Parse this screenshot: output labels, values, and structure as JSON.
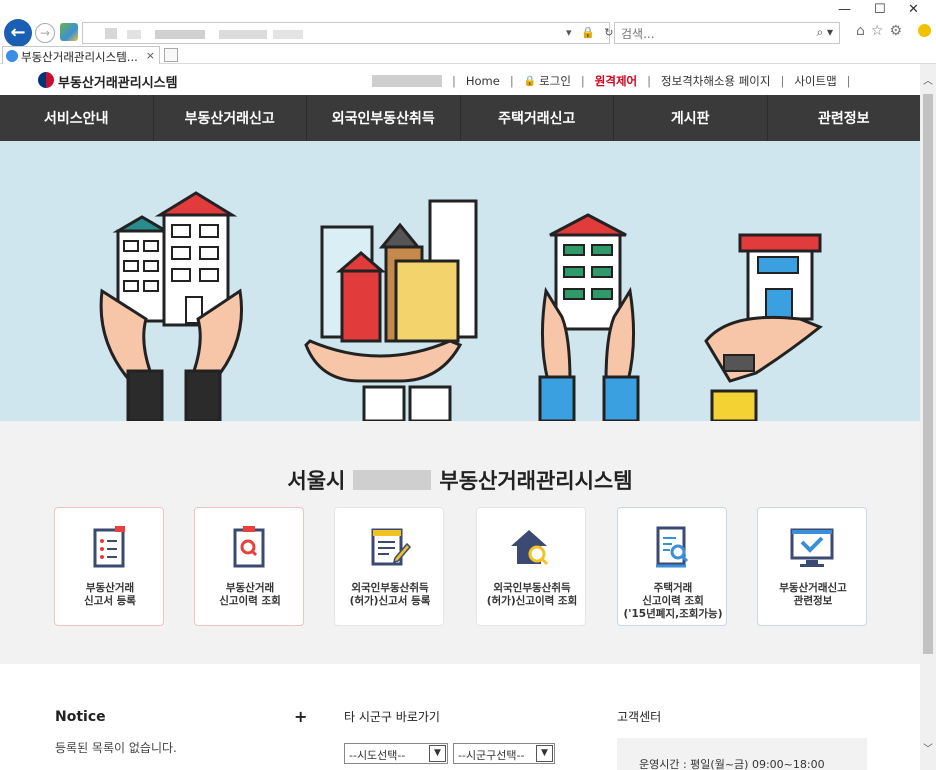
{
  "browser": {
    "window_controls": {
      "minimize": "—",
      "maximize": "☐",
      "close": "✕"
    },
    "search": {
      "placeholder": "검색..."
    },
    "tab": {
      "title": "부동산거래관리시스템...",
      "close": "×"
    },
    "address_tools": "▾ 🔒 ↻",
    "search_glyph": "⌕ ▾",
    "toolbar_icons": "⌂☆⚙"
  },
  "header": {
    "logo_text": "부동산거래관리시스템",
    "util_links": {
      "home": "Home",
      "login": "로그인",
      "remote": "원격제어",
      "accessibility": "정보격차해소용 페이지",
      "sitemap": "사이트맵"
    }
  },
  "nav": {
    "items": [
      "서비스안내",
      "부동산거래신고",
      "외국인부동산취득",
      "주택거래신고",
      "게시판",
      "관련정보"
    ]
  },
  "services": {
    "title_prefix": "서울시",
    "title_suffix": "부동산거래관리시스템",
    "cards": [
      {
        "label": "부동산거래\n신고서 등록"
      },
      {
        "label": "부동산거래\n신고이력 조회"
      },
      {
        "label": "외국인부동산취득\n(허가)신고서 등록"
      },
      {
        "label": "외국인부동산취득\n(허가)신고이력 조회"
      },
      {
        "label": "주택거래\n신고이력 조회\n('15년폐지,조회가능)"
      },
      {
        "label": "부동산거래신고\n관련정보"
      }
    ]
  },
  "bottom": {
    "notice_title": "Notice",
    "notice_more": "+",
    "notice_empty": "등록된 목록이 없습니다.",
    "quick_title": "타 시군구 바로가기",
    "select_sido": "--시도선택--",
    "select_sigungu": "--시군구선택--",
    "cs_title": "고객센터",
    "cs_hours": "운영시간 : 평일(월~금) 09:00~18:00"
  },
  "colors": {
    "nav_bg": "#3a3a3a",
    "hero_bg": "#cfe6ee",
    "accent_red": "#d0021b",
    "card_red": "#e8413c",
    "card_navy": "#3b4a73",
    "card_gold": "#f3c324",
    "card_blue": "#3b8ed8"
  }
}
